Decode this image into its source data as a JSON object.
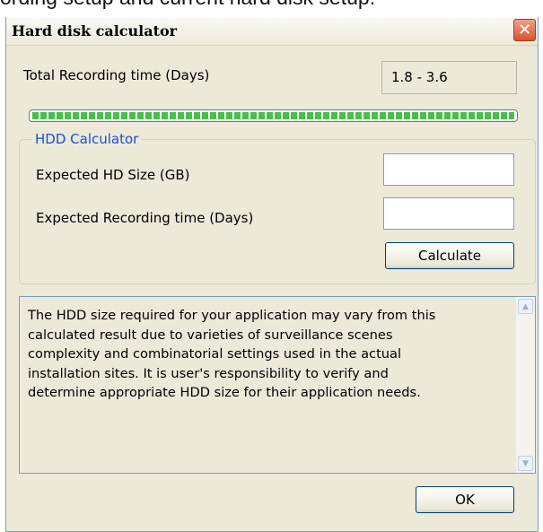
{
  "background_caption": "ording setup and current hard disk setup.",
  "window": {
    "title": "Hard disk calculator",
    "close_glyph": "✕"
  },
  "total_recording": {
    "label": "Total Recording time (Days)",
    "value": "1.8 - 3.6",
    "progress_fraction": 1.0
  },
  "hdd_calculator": {
    "legend": "HDD Calculator",
    "hd_size_label": "Expected HD Size (GB)",
    "hd_size_value": "",
    "recording_time_label": "Expected Recording time (Days)",
    "recording_time_value": "",
    "calculate_button": "Calculate"
  },
  "notice": {
    "lines": [
      "The HDD size required for your application may vary from this",
      "calculated result due to varieties of surveillance scenes",
      "complexity and combinatorial settings used in the actual",
      "installation sites. It is user's responsibility to verify and",
      "determine appropriate HDD size for their application needs."
    ],
    "scroll_up_icon": "▲",
    "scroll_down_icon": "▼"
  },
  "ok_button": "OK",
  "colors": {
    "dialog_bg": "#ece9d8",
    "legend_text": "#1a4fd6",
    "progress_green": "#47c04a",
    "close_red": "#d8532f",
    "field_border": "#7f9db9"
  }
}
